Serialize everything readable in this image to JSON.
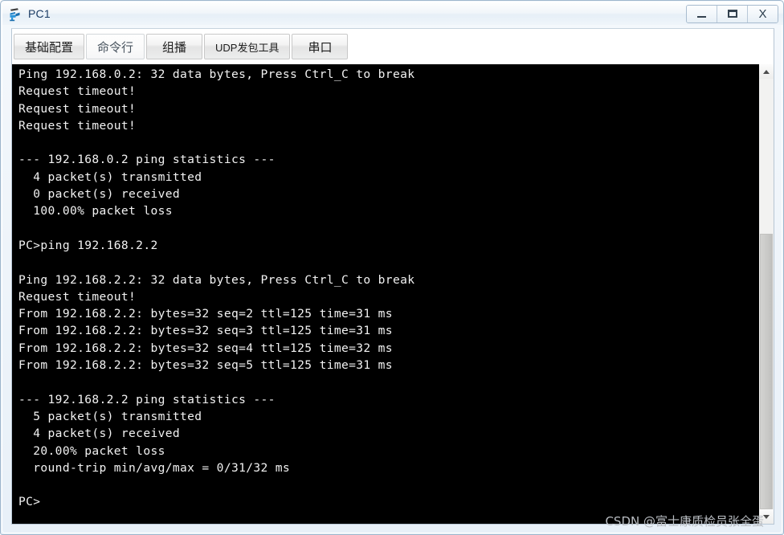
{
  "window": {
    "title": "PC1",
    "icon": "pc-device-icon",
    "controls": {
      "minimize_label": "—",
      "maximize_label": "❐",
      "close_label": "X"
    }
  },
  "tabs": [
    {
      "label": "基础配置",
      "active": false,
      "name": "tab-basic-config"
    },
    {
      "label": "命令行",
      "active": true,
      "name": "tab-command-line"
    },
    {
      "label": "组播",
      "active": false,
      "name": "tab-multicast"
    },
    {
      "label": "UDP发包工具",
      "active": false,
      "name": "tab-udp-tool"
    },
    {
      "label": "串口",
      "active": false,
      "name": "tab-serial-port"
    }
  ],
  "terminal": {
    "lines": [
      "Ping 192.168.0.2: 32 data bytes, Press Ctrl_C to break",
      "Request timeout!",
      "Request timeout!",
      "Request timeout!",
      "",
      "--- 192.168.0.2 ping statistics ---",
      "  4 packet(s) transmitted",
      "  0 packet(s) received",
      "  100.00% packet loss",
      "",
      "PC>ping 192.168.2.2",
      "",
      "Ping 192.168.2.2: 32 data bytes, Press Ctrl_C to break",
      "Request timeout!",
      "From 192.168.2.2: bytes=32 seq=2 ttl=125 time=31 ms",
      "From 192.168.2.2: bytes=32 seq=3 ttl=125 time=31 ms",
      "From 192.168.2.2: bytes=32 seq=4 ttl=125 time=32 ms",
      "From 192.168.2.2: bytes=32 seq=5 ttl=125 time=31 ms",
      "",
      "--- 192.168.2.2 ping statistics ---",
      "  5 packet(s) transmitted",
      "  4 packet(s) received",
      "  20.00% packet loss",
      "  round-trip min/avg/max = 0/31/32 ms",
      "",
      "PC>"
    ]
  },
  "scrollbar": {
    "up_arrow": "chevron-up-icon",
    "down_arrow": "chevron-down-icon",
    "thumb_top_pct": 36
  },
  "watermark": {
    "text": "CSDN @富士康质检员张全蛋"
  },
  "colors": {
    "terminal_bg": "#000000",
    "terminal_fg": "#f2f2f2",
    "frame": "#9eb6cc",
    "title_text": "#1b3c64"
  }
}
